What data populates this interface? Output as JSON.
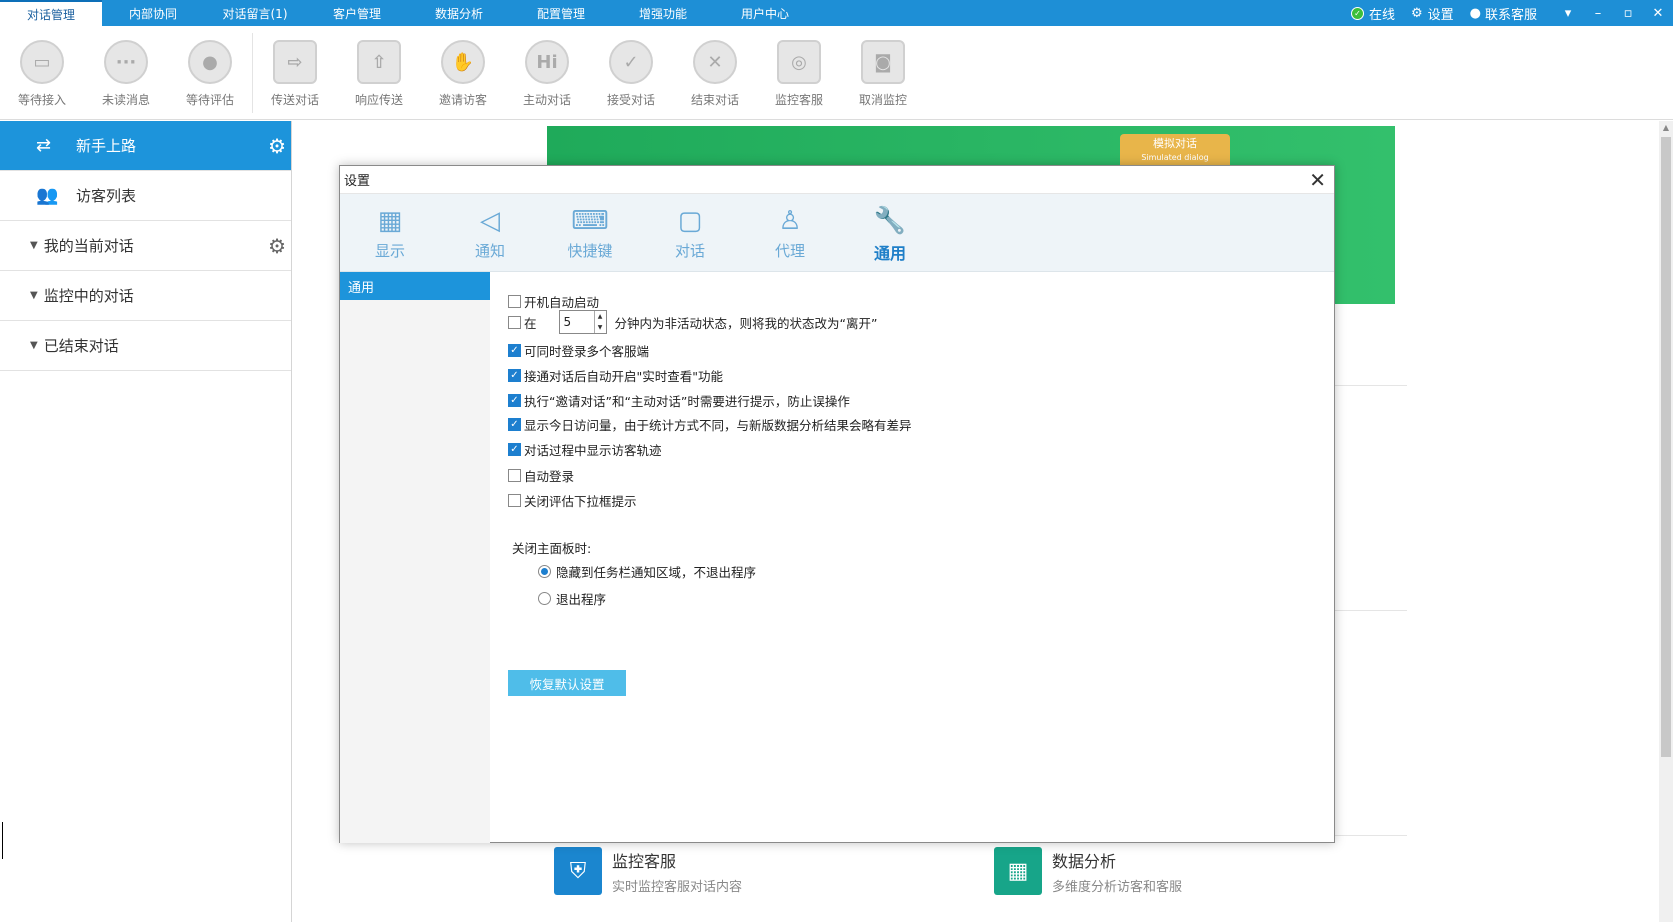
{
  "top_tabs": [
    {
      "label": "对话管理",
      "active": true
    },
    {
      "label": "内部协同"
    },
    {
      "label": "对话留言(1)"
    },
    {
      "label": "客户管理"
    },
    {
      "label": "数据分析"
    },
    {
      "label": "配置管理"
    },
    {
      "label": "增强功能"
    },
    {
      "label": "用户中心"
    }
  ],
  "top_right": {
    "status": "在线",
    "settings": "设置",
    "contact": "联系客服"
  },
  "toolbar": [
    {
      "label": "等待接入",
      "icon": "chat-wait-icon"
    },
    {
      "label": "未读消息",
      "icon": "unread-message-icon"
    },
    {
      "label": "等待评估",
      "icon": "rating-wait-icon"
    },
    {
      "label": "传送对话",
      "icon": "transfer-icon"
    },
    {
      "label": "响应传送",
      "icon": "response-transfer-icon"
    },
    {
      "label": "邀请访客",
      "icon": "invite-hand-icon"
    },
    {
      "label": "主动对话",
      "icon": "hi-bubble-icon"
    },
    {
      "label": "接受对话",
      "icon": "check-icon"
    },
    {
      "label": "结束对话",
      "icon": "close-circle-icon"
    },
    {
      "label": "监控客服",
      "icon": "binoculars-icon"
    },
    {
      "label": "取消监控",
      "icon": "binoculars-cancel-icon"
    }
  ],
  "sidebar": {
    "items": [
      {
        "label": "新手上路",
        "active": true
      },
      {
        "label": "访客列表"
      }
    ],
    "groups": [
      {
        "label": "我的当前对话"
      },
      {
        "label": "监控中的对话"
      },
      {
        "label": "已结束对话"
      }
    ]
  },
  "main": {
    "banner_tag": "模拟对话",
    "banner_tag_sub": "Simulated dialog",
    "features": [
      {
        "title": "监控客服",
        "desc": "实时监控客服对话内容",
        "color": "#1b86cf"
      },
      {
        "title": "数据分析",
        "desc": "多维度分析访客和客服",
        "color": "#17a589"
      }
    ]
  },
  "dialog": {
    "title": "设置",
    "tabs": [
      {
        "label": "显示",
        "icon": "grid-icon"
      },
      {
        "label": "通知",
        "icon": "speaker-icon"
      },
      {
        "label": "快捷键",
        "icon": "keyboard-icon"
      },
      {
        "label": "对话",
        "icon": "chat-bubble-icon"
      },
      {
        "label": "代理",
        "icon": "user-add-icon"
      },
      {
        "label": "通用",
        "icon": "wrench-icon",
        "active": true
      }
    ],
    "nav_item": "通用",
    "options": {
      "autostart": {
        "label": "开机自动启动",
        "checked": false
      },
      "idle_prefix": "在",
      "idle_minutes": "5",
      "idle_suffix": "分钟内为非活动状态，则将我的状态改为“离开”",
      "idle_checked": false,
      "multi_login": {
        "label": "可同时登录多个客服端",
        "checked": true
      },
      "realtime_view": {
        "label": "接通对话后自动开启\"实时查看\"功能",
        "checked": true
      },
      "confirm_invite": {
        "label": "执行“邀请对话”和“主动对话”时需要进行提示，防止误操作",
        "checked": true
      },
      "show_visits": {
        "label": "显示今日访问量，由于统计方式不同，与新版数据分析结果会略有差异",
        "checked": true
      },
      "show_trail": {
        "label": "对话过程中显示访客轨迹",
        "checked": true
      },
      "auto_login": {
        "label": "自动登录",
        "checked": false
      },
      "close_rating_dropdown": {
        "label": "关闭评估下拉框提示",
        "checked": false
      }
    },
    "close_panel": {
      "label": "关闭主面板时:",
      "options": [
        {
          "label": "隐藏到任务栏通知区域，不退出程序",
          "selected": true
        },
        {
          "label": "退出程序",
          "selected": false
        }
      ]
    },
    "restore_button": "恢复默认设置"
  }
}
